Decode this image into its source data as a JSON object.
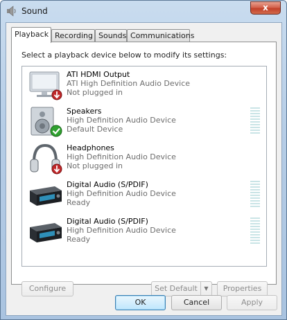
{
  "window": {
    "title": "Sound",
    "close_label": "x"
  },
  "tabs": [
    {
      "label": "Playback",
      "active": true
    },
    {
      "label": "Recording",
      "active": false
    },
    {
      "label": "Sounds",
      "active": false
    },
    {
      "label": "Communications",
      "active": false
    }
  ],
  "instruction": "Select a playback device below to modify its settings:",
  "devices": [
    {
      "name": "ATI HDMI Output",
      "description": "ATI High Definition Audio Device",
      "status": "Not plugged in",
      "icon": "monitor-icon",
      "badge": "red-down-arrow-badge",
      "level_meter": false
    },
    {
      "name": "Speakers",
      "description": "High Definition Audio Device",
      "status": "Default Device",
      "icon": "speaker-icon",
      "badge": "green-check-badge",
      "level_meter": true
    },
    {
      "name": "Headphones",
      "description": "High Definition Audio Device",
      "status": "Not plugged in",
      "icon": "headphones-icon",
      "badge": "red-down-arrow-badge",
      "level_meter": false
    },
    {
      "name": "Digital Audio (S/PDIF)",
      "description": "High Definition Audio Device",
      "status": "Ready",
      "icon": "digital-audio-receiver-icon",
      "badge": "",
      "level_meter": true
    },
    {
      "name": "Digital Audio (S/PDIF)",
      "description": "High Definition Audio Device",
      "status": "Ready",
      "icon": "digital-audio-receiver-icon",
      "badge": "",
      "level_meter": true
    }
  ],
  "buttons": {
    "configure": "Configure",
    "set_default": "Set Default",
    "properties": "Properties",
    "ok": "OK",
    "cancel": "Cancel",
    "apply": "Apply"
  },
  "colors": {
    "title_bar": "#b6cde6",
    "close_button": "#c2412a",
    "level_meter": "#c9e4e6",
    "default_badge": "#2fa12f",
    "unplugged_badge": "#c0282a"
  }
}
